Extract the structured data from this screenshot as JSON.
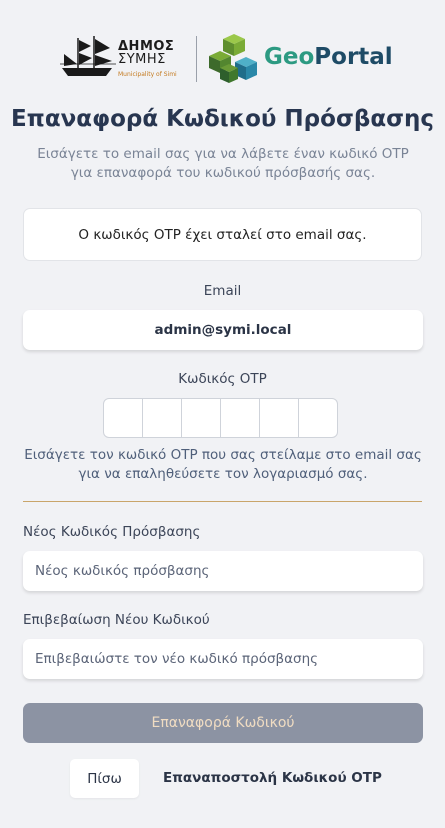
{
  "header": {
    "municipality_line1": "ΔΗΜΟΣ",
    "municipality_line2": "ΣΥΜΗΣ",
    "municipality_en": "Municipality of Simi",
    "brand_geo": "Geo",
    "brand_portal": "Portal"
  },
  "page": {
    "title": "Επαναφορά Κωδικού Πρόσβασης",
    "subtitle": "Εισάγετε το email σας για να λάβετε έναν κωδικό OTP για επαναφορά του κωδικού πρόσβασής σας."
  },
  "alert": {
    "message": "Ο κωδικός OTP έχει σταλεί στο email σας."
  },
  "form": {
    "email_label": "Email",
    "email_value": "admin@symi.local",
    "otp_label": "Κωδικός OTP",
    "otp_digits": [
      "",
      "",
      "",
      "",
      "",
      ""
    ],
    "otp_help": "Εισάγετε τον κωδικό OTP που σας στείλαμε στο email σας για να επαληθεύσετε τον λογαριασμό σας.",
    "new_password_label": "Νέος Κωδικός Πρόσβασης",
    "new_password_placeholder": "Νέος κωδικός πρόσβασης",
    "confirm_password_label": "Επιβεβαίωση Νέου Κωδικού",
    "confirm_password_placeholder": "Επιβεβαιώστε τον νέο κωδικό πρόσβασης",
    "submit_label": "Επαναφορά Κωδικού",
    "back_label": "Πίσω",
    "resend_label": "Επαναποστολή Κωδικού OTP"
  },
  "colors": {
    "background": "#f1f2f5",
    "title": "#283650",
    "brand_geo": "#2c9a82",
    "brand_portal": "#1e4b66",
    "submit_bg": "#8c93a3",
    "divider": "#c9a56a"
  }
}
